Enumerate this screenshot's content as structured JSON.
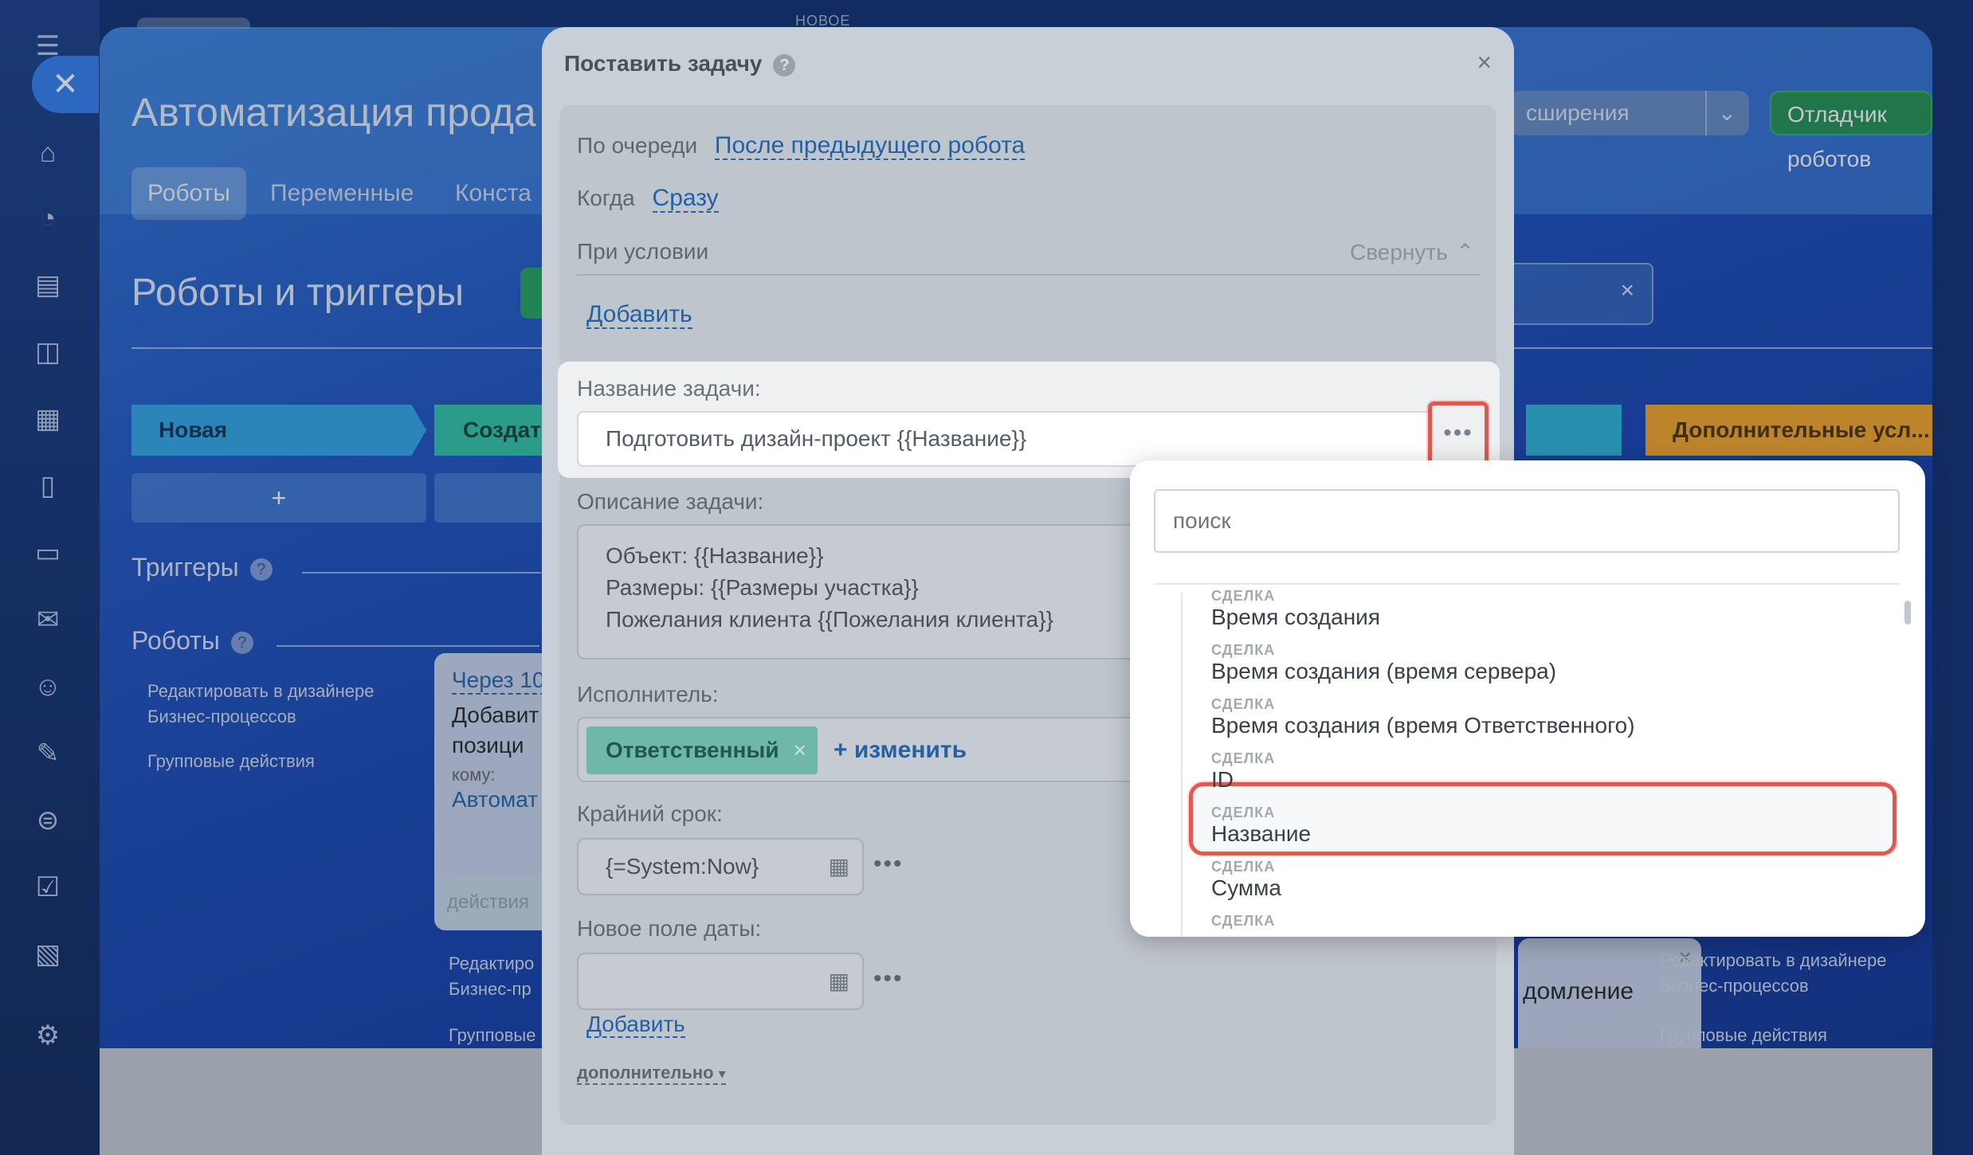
{
  "page": {
    "title": "Автоматизация прода",
    "tabs": [
      "Роботы",
      "Переменные",
      "Конста"
    ],
    "ext_btn": "сширения",
    "debugger_btn": "Отладчик роботов",
    "top_new": "НОВОЕ",
    "section_title": "Роботы и триггеры",
    "stages": [
      "Новая",
      "Создать",
      "Дополнительные усл..."
    ],
    "plus": "+",
    "triggers_label": "Триггеры",
    "robots_label": "Роботы",
    "side_links": [
      "Редактировать в дизайнере Бизнес-процессов",
      "Групповые действия"
    ],
    "card": {
      "when": "Через 10",
      "line1": "Добавит",
      "line2": "позици",
      "to": "кому:",
      "who": "Автомат",
      "footer": "действия"
    },
    "card2": {
      "l1": "Редактиро",
      "l2": "Бизнес-пр",
      "l3": "Групповые"
    },
    "right_card_text": "домление",
    "right_links": [
      "Редактировать в дизайнере Бизнес-процессов",
      "Групповые действия"
    ]
  },
  "dialog": {
    "title": "Поставить задачу",
    "close": "×",
    "queue_label": "По очереди",
    "queue_value": "После предыдущего робота",
    "when_label": "Когда",
    "when_value": "Сразу",
    "condition_label": "При условии",
    "collapse": "Свернуть",
    "add_label": "Добавить",
    "task_name_label": "Название задачи:",
    "task_name_value": "Подготовить дизайн-проект {{Название}}",
    "description_label": "Описание задачи:",
    "description_lines": [
      "Объект: {{Название}}",
      "Размеры: {{Размеры участка}}",
      "Пожелания клиента {{Пожелания клиента}}"
    ],
    "executor_label": "Исполнитель:",
    "executor_chip": "Ответственный",
    "executor_change": "+ изменить",
    "deadline_label": "Крайний срок:",
    "deadline_value": "{=System:Now}",
    "new_date_label": "Новое поле даты:",
    "add2": "Добавить",
    "more": "дополнительно"
  },
  "dropdown": {
    "search_placeholder": "поиск",
    "items": [
      {
        "cat": "СДЕЛКА",
        "name": "Время создания"
      },
      {
        "cat": "СДЕЛКА",
        "name": "Время создания (время сервера)"
      },
      {
        "cat": "СДЕЛКА",
        "name": "Время создания (время Ответственного)"
      },
      {
        "cat": "СДЕЛКА",
        "name": "ID"
      },
      {
        "cat": "СДЕЛКА",
        "name": "Название"
      },
      {
        "cat": "СДЕЛКА",
        "name": "Сумма"
      },
      {
        "cat": "СДЕЛКА",
        "name": ""
      }
    ]
  },
  "colors": {
    "accent_green": "#20a35a",
    "stage_blue": "#2fa6e6",
    "stage_teal": "#2ec5a6",
    "stage_orange": "#f5a623",
    "highlight_red": "#e2584f"
  }
}
